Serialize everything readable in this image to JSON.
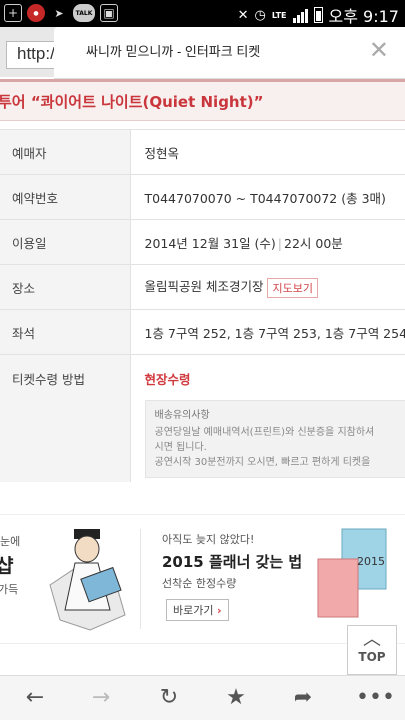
{
  "status_bar": {
    "lte": "LTE",
    "clock": "오후 9:17",
    "left_icons": [
      "plus-box-icon",
      "record-icon",
      "send-icon",
      "talk-icon",
      "image-icon"
    ],
    "talk_label": "TALK"
  },
  "browser": {
    "url": "http://"
  },
  "dialog": {
    "title": "싸니까 믿으니까 - 인터파크 티켓",
    "close_glyph": "✕"
  },
  "event": {
    "title": "투어 “콰이어트 나이트(Quiet Night)”"
  },
  "booking": {
    "rows": [
      {
        "label": "예매자",
        "value": "정현옥"
      },
      {
        "label": "예약번호",
        "value": "T0447070070 ~ T0447070072 (총 3매)"
      },
      {
        "label": "이용일",
        "date": "2014년 12월 31일 (수)",
        "time": "22시 00분"
      },
      {
        "label": "장소",
        "venue": "올림픽공원 체조경기장",
        "map_link": "지도보기"
      },
      {
        "label": "좌석",
        "value": "1층 7구역 252, 1층 7구역 253, 1층 7구역 254"
      }
    ],
    "ticket_method": {
      "label": "티켓수령 방법",
      "value": "현장수령",
      "notice_title": "배송유의사항",
      "notice_line1": "공연당일날 예매내역서(프린트)와 신분증을 지참하셔",
      "notice_line2": "시면 됩니다.",
      "notice_line3": "공연시작 30분전까지 오시면, 빠르고 편하게 티켓을"
    }
  },
  "ad": {
    "left_line1": "눈에",
    "left_line2": "샵",
    "left_line3": "가득",
    "right_line1": "아직도 늦지 않았다!",
    "right_line2": "2015 플래너 갖는 법",
    "right_line3": "선착순 한정수량",
    "right_button": "바로가기",
    "planner_year": "2015"
  },
  "top_button": {
    "label": "TOP"
  },
  "nav": {
    "items": [
      "back-icon",
      "forward-icon",
      "refresh-icon",
      "bookmark-icon",
      "share-icon",
      "more-icon"
    ]
  }
}
